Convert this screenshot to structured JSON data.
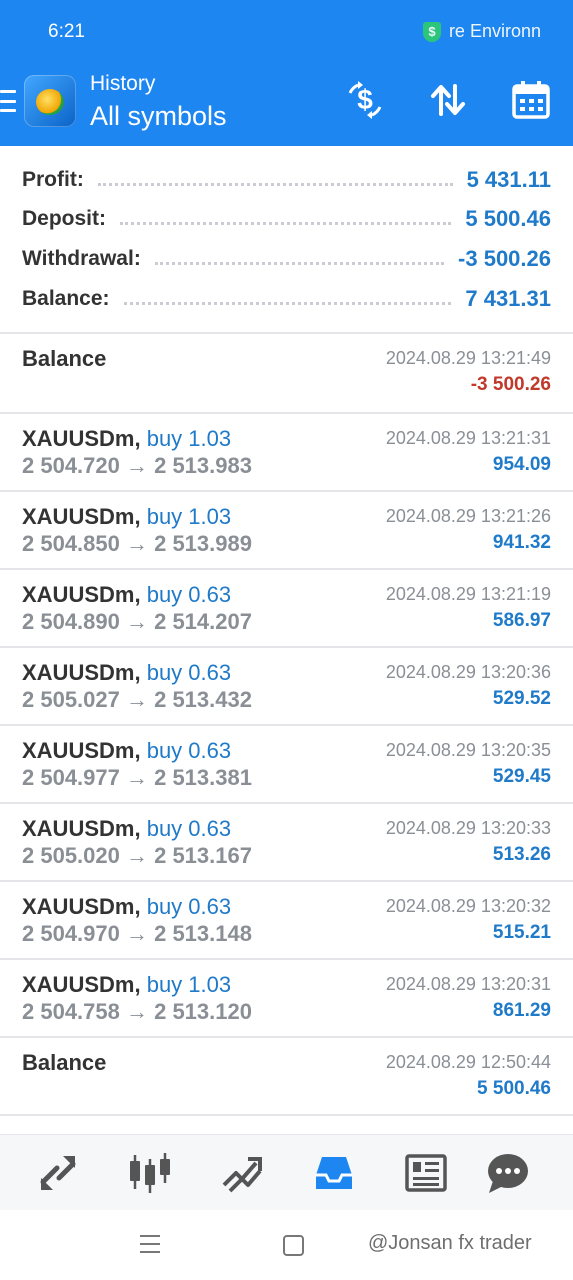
{
  "status_bar": {
    "time": "6:21",
    "vpn_text": "re Environn"
  },
  "app_bar": {
    "subtitle": "History",
    "title": "All symbols"
  },
  "summary": {
    "profit_label": "Profit:",
    "profit_value": "5 431.11",
    "deposit_label": "Deposit:",
    "deposit_value": "5 500.46",
    "withdrawal_label": "Withdrawal:",
    "withdrawal_value": "-3 500.26",
    "balance_label": "Balance:",
    "balance_value": "7 431.31"
  },
  "entries": [
    {
      "symbol": "Balance",
      "time": "2024.08.29 13:21:49",
      "amount": "-3 500.26",
      "negative": true
    },
    {
      "symbol": "XAUUSDm,",
      "side": "buy 1.03",
      "prices": "2 504.720 → 2 513.983",
      "time": "2024.08.29 13:21:31",
      "amount": "954.09"
    },
    {
      "symbol": "XAUUSDm,",
      "side": "buy 1.03",
      "prices": "2 504.850 → 2 513.989",
      "time": "2024.08.29 13:21:26",
      "amount": "941.32"
    },
    {
      "symbol": "XAUUSDm,",
      "side": "buy 0.63",
      "prices": "2 504.890 → 2 514.207",
      "time": "2024.08.29 13:21:19",
      "amount": "586.97"
    },
    {
      "symbol": "XAUUSDm,",
      "side": "buy 0.63",
      "prices": "2 505.027 → 2 513.432",
      "time": "2024.08.29 13:20:36",
      "amount": "529.52"
    },
    {
      "symbol": "XAUUSDm,",
      "side": "buy 0.63",
      "prices": "2 504.977 → 2 513.381",
      "time": "2024.08.29 13:20:35",
      "amount": "529.45"
    },
    {
      "symbol": "XAUUSDm,",
      "side": "buy 0.63",
      "prices": "2 505.020 → 2 513.167",
      "time": "2024.08.29 13:20:33",
      "amount": "513.26"
    },
    {
      "symbol": "XAUUSDm,",
      "side": "buy 0.63",
      "prices": "2 504.970 → 2 513.148",
      "time": "2024.08.29 13:20:32",
      "amount": "515.21"
    },
    {
      "symbol": "XAUUSDm,",
      "side": "buy 1.03",
      "prices": "2 504.758 → 2 513.120",
      "time": "2024.08.29 13:20:31",
      "amount": "861.29"
    },
    {
      "symbol": "Balance",
      "time": "2024.08.29 12:50:44",
      "amount": "5 500.46"
    }
  ],
  "bottom_nav": [
    {
      "icon": "quotes-icon"
    },
    {
      "icon": "chart-icon"
    },
    {
      "icon": "trade-icon"
    },
    {
      "icon": "history-icon",
      "active": true
    },
    {
      "icon": "news-icon"
    },
    {
      "icon": "chat-icon"
    }
  ],
  "watermark": "@Jonsan fx trader",
  "colors": {
    "primary": "#1e86f0",
    "profit": "#1f7ac9",
    "loss": "#c0392b"
  }
}
